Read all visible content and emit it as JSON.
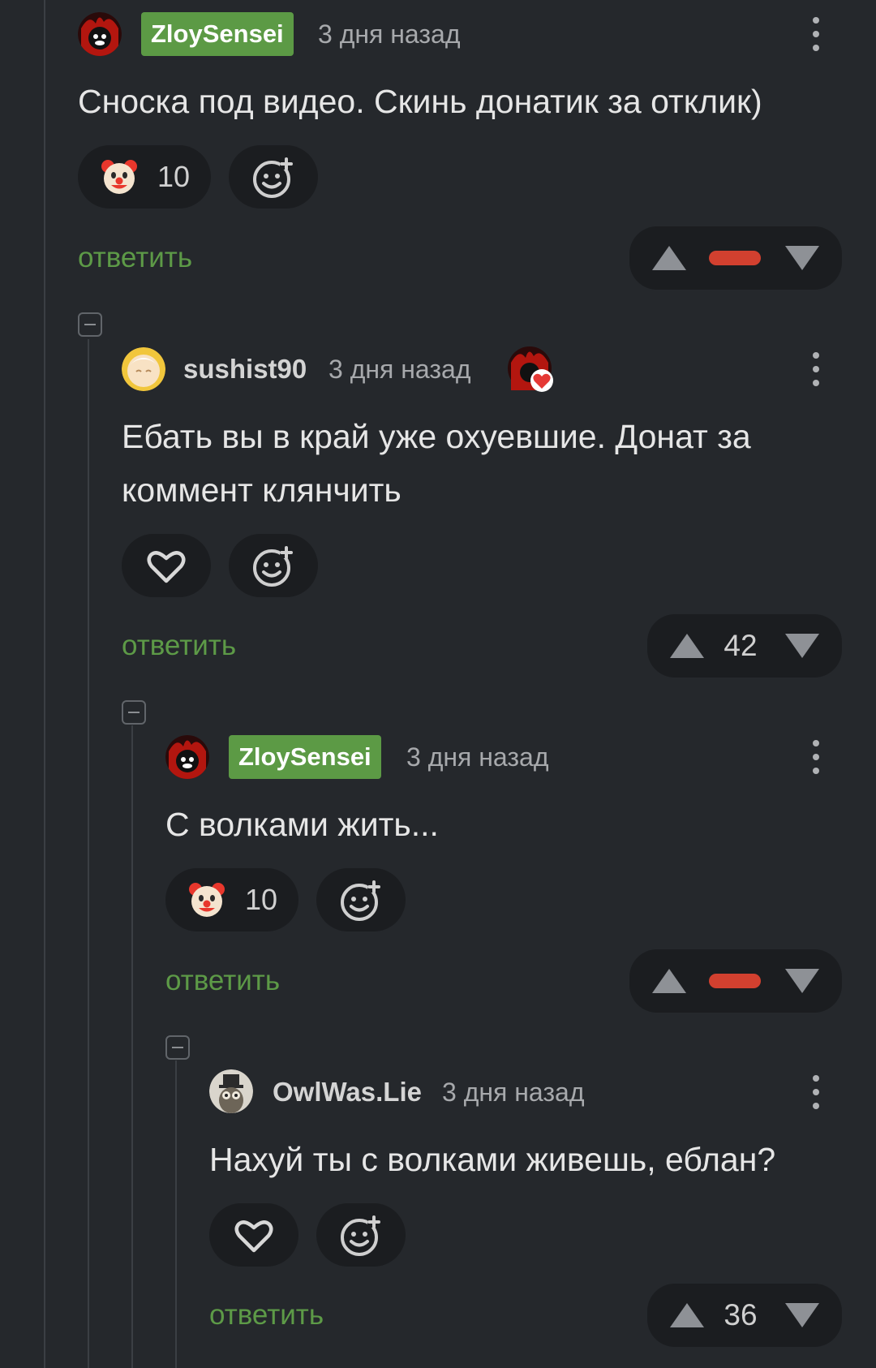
{
  "comments": [
    {
      "author": "ZloySensei",
      "time": "3 дня назад",
      "text": "Сноска под видео. Скинь донатик за отклик)",
      "reaction": {
        "icon": "clown-emoji-icon",
        "count": "10"
      },
      "reply_label": "ответить",
      "rating": {
        "display": "negative-dash",
        "color": "#d2402f"
      }
    },
    {
      "author": "sushist90",
      "time": "3 дня назад",
      "text": "Ебать вы в край уже охуевшие. Донат за коммент клянчить",
      "reaction": {
        "icon": "heart-icon",
        "count": ""
      },
      "reply_label": "ответить",
      "rating": {
        "display": "number",
        "value": "42"
      }
    },
    {
      "author": "ZloySensei",
      "time": "3 дня назад",
      "text": "С волками жить...",
      "reaction": {
        "icon": "clown-emoji-icon",
        "count": "10"
      },
      "reply_label": "ответить",
      "rating": {
        "display": "negative-dash",
        "color": "#d2402f"
      }
    },
    {
      "author": "OwlWas.Lie",
      "time": "3 дня назад",
      "text": "Нахуй ты с волками живешь, еблан?",
      "reaction": {
        "icon": "heart-icon",
        "count": ""
      },
      "reply_label": "ответить",
      "rating": {
        "display": "number",
        "value": "36"
      }
    }
  ],
  "colors": {
    "background": "#25282c",
    "author_badge": "#5c9a45",
    "reply_link": "#5d9a47",
    "negative_rating": "#d2402f",
    "pill": "#1b1d20"
  }
}
